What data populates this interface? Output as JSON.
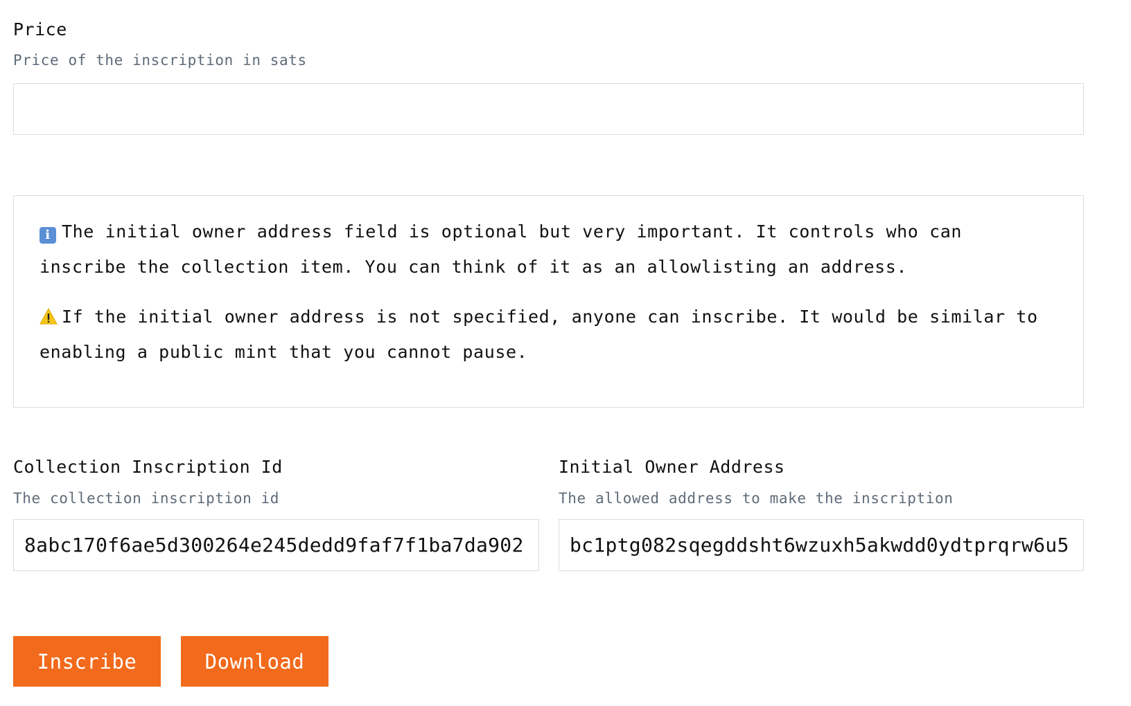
{
  "price": {
    "label": "Price",
    "description": "Price of the inscription in sats",
    "value": ""
  },
  "notice": {
    "info_icon": "info-icon",
    "info_text": "The initial owner address field is optional but very important. It controls who can inscribe the collection item. You can think of it as an allowlisting an address.",
    "warning_icon": "warning-icon",
    "warning_text": "If the initial owner address is not specified, anyone can inscribe. It would be similar to enabling a public mint that you cannot pause."
  },
  "collection_inscription_id": {
    "label": "Collection Inscription Id",
    "description": "The collection inscription id",
    "value": "8abc170f6ae5d300264e245dedd9faf7f1ba7da902"
  },
  "initial_owner_address": {
    "label": "Initial Owner Address",
    "description": "The allowed address to make the inscription",
    "value": "bc1ptg082sqegddsht6wzuxh5akwdd0ydtprqrw6u5"
  },
  "actions": {
    "inscribe_label": "Inscribe",
    "download_label": "Download"
  },
  "colors": {
    "accent": "#f26a1b",
    "border": "#d9dde3",
    "muted_text": "#5f6b7a"
  }
}
